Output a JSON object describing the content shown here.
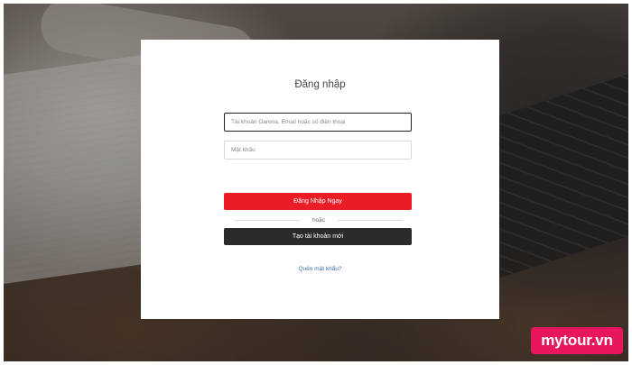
{
  "login": {
    "title": "Đăng nhập",
    "account_placeholder": "Tài khoản Garena, Email hoặc số điện thoại",
    "password_placeholder": "Mật khẩu",
    "login_button": "Đăng Nhập Ngay",
    "divider_text": "hoặc",
    "create_button": "Tạo tài khoản mới",
    "forgot_link": "Quên mật khẩu?"
  },
  "watermark": {
    "text": "mytour.vn"
  },
  "colors": {
    "primary_red": "#ec1c27",
    "dark_button": "#2b2b2b",
    "link_blue": "#3b6ea8",
    "watermark_pink": "#e8175d"
  }
}
